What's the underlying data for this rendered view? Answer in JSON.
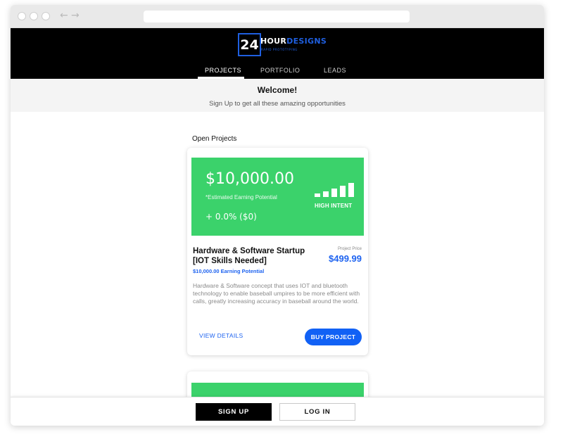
{
  "brand": {
    "logo_number": "24",
    "logo_word_a": "HOUR",
    "logo_word_b": "DESIGNS",
    "logo_tagline": "RAPID PROTOTYPING",
    "accent": "#1f5fe0"
  },
  "nav": {
    "tabs": [
      {
        "label": "PROJECTS"
      },
      {
        "label": "PORTFOLIO"
      },
      {
        "label": "LEADS"
      }
    ],
    "active": "PROJECTS"
  },
  "welcome": {
    "title": "Welcome!",
    "subtitle": "Sign Up to get all these amazing opportunities"
  },
  "section": {
    "title": "Open Projects"
  },
  "project": {
    "amount": "$10,000.00",
    "amount_note": "*Estimated Earning Potential",
    "change": "+ 0.0% ($0)",
    "intent": "HIGH INTENT",
    "intent_level": 5,
    "title": "Hardware & Software Startup [IOT Skills Needed]",
    "subtitle": "$10,000.00 Earning Potential",
    "price_label": "Project Price",
    "price": "$499.99",
    "description": "Hardware & Software concept that uses IOT and bluetooth technology to enable baseball umpires to be more efficient with calls, greatly increasing accuracy in baseball around the world.",
    "view_label": "VIEW DETAILS",
    "buy_label": "BUY PROJECT",
    "banner_color": "#3bd26b"
  },
  "footer": {
    "signup_label": "SIGN UP",
    "login_label": "LOG IN"
  },
  "icons": {
    "back": "arrow-left-icon",
    "forward": "arrow-right-icon",
    "signal": "signal-bars-icon"
  }
}
